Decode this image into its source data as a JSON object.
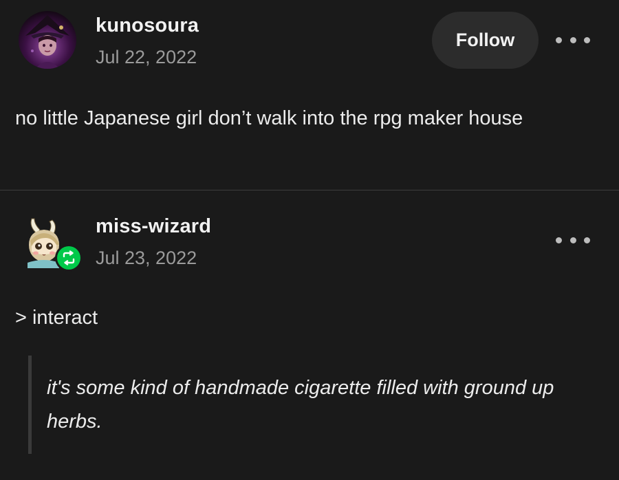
{
  "posts": [
    {
      "username": "kunosoura",
      "date": "Jul 22, 2022",
      "follow_label": "Follow",
      "body": "no little Japanese girl don’t walk into the rpg maker house",
      "more_icon": "more-icon"
    },
    {
      "username": "miss-wizard",
      "date": "Jul 23, 2022",
      "reblog_icon": "reblog-icon",
      "body": "> interact",
      "quote": "it's some kind of handmade cigarette filled with ground up herbs.",
      "more_icon": "more-icon"
    }
  ],
  "colors": {
    "background": "#1a1a1a",
    "text": "#ececec",
    "muted": "#9b9b9b",
    "follow_bg": "#2c2c2c",
    "reblog_green": "#00c94a",
    "divider": "#3d3d3d"
  }
}
